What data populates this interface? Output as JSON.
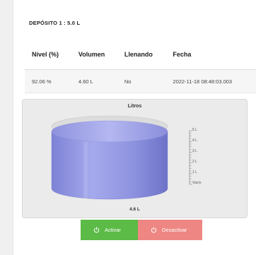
{
  "deposit": {
    "title": "DEPÓSITO 1 : 5.0 L"
  },
  "table": {
    "headers": [
      "Nivel (%)",
      "Volumen",
      "Llenando",
      "Fecha"
    ],
    "row": [
      "92.06 %",
      "4.60 L",
      "No",
      "2022-11-18 08:48:03.003"
    ]
  },
  "chart": {
    "title": "Litros",
    "value_label": "4.6 L",
    "ticks": [
      "5 L",
      "4 L",
      "3 L",
      "2 L",
      "1 L",
      "Vacío"
    ]
  },
  "chart_data": {
    "type": "gauge",
    "title": "Litros",
    "value": 4.6,
    "unit": "L",
    "range": [
      0,
      5
    ],
    "tick_labels": [
      "5 L",
      "4 L",
      "3 L",
      "2 L",
      "1 L",
      "Vacío"
    ],
    "fill_color": "#9a9ee6"
  },
  "buttons": {
    "activate_label": "Activar",
    "deactivate_label": "Desactivar"
  },
  "colors": {
    "activate": "#5cba47",
    "deactivate": "#ee8783",
    "liquid": "#9a9ee6"
  }
}
